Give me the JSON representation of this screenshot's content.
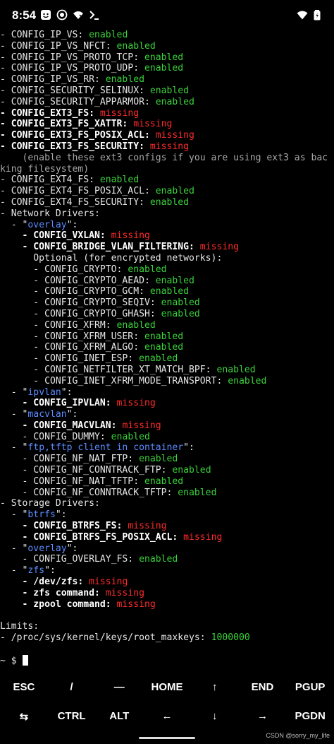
{
  "status": {
    "time": "8:54",
    "left_icons": [
      "face-icon",
      "record-icon",
      "wifi-off-icon",
      "terminal-icon"
    ],
    "right_icons": [
      "wifi-icon",
      "battery-icon"
    ]
  },
  "terminal": {
    "lines": [
      [
        {
          "t": "- CONFIG_IP_VS: ",
          "c": "plain"
        },
        {
          "t": "enabled",
          "c": "green"
        }
      ],
      [
        {
          "t": "- CONFIG_IP_VS_NFCT: ",
          "c": "plain"
        },
        {
          "t": "enabled",
          "c": "green"
        }
      ],
      [
        {
          "t": "- CONFIG_IP_VS_PROTO_TCP: ",
          "c": "plain"
        },
        {
          "t": "enabled",
          "c": "green"
        }
      ],
      [
        {
          "t": "- CONFIG_IP_VS_PROTO_UDP: ",
          "c": "plain"
        },
        {
          "t": "enabled",
          "c": "green"
        }
      ],
      [
        {
          "t": "- CONFIG_IP_VS_RR: ",
          "c": "plain"
        },
        {
          "t": "enabled",
          "c": "green"
        }
      ],
      [
        {
          "t": "- CONFIG_SECURITY_SELINUX: ",
          "c": "plain"
        },
        {
          "t": "enabled",
          "c": "green"
        }
      ],
      [
        {
          "t": "- CONFIG_SECURITY_APPARMOR: ",
          "c": "plain"
        },
        {
          "t": "enabled",
          "c": "green"
        }
      ],
      [
        {
          "t": "- CONFIG_EXT3_FS: ",
          "c": "bold"
        },
        {
          "t": "missing",
          "c": "red"
        }
      ],
      [
        {
          "t": "- CONFIG_EXT3_FS_XATTR: ",
          "c": "bold"
        },
        {
          "t": "missing",
          "c": "red"
        }
      ],
      [
        {
          "t": "- CONFIG_EXT3_FS_POSIX_ACL: ",
          "c": "bold"
        },
        {
          "t": "missing",
          "c": "red"
        }
      ],
      [
        {
          "t": "- CONFIG_EXT3_FS_SECURITY: ",
          "c": "bold"
        },
        {
          "t": "missing",
          "c": "red"
        }
      ],
      [
        {
          "t": "    (enable these ext3 configs if you are using ext3 as bac",
          "c": "gray"
        }
      ],
      [
        {
          "t": "king filesystem)",
          "c": "gray"
        }
      ],
      [
        {
          "t": "- CONFIG_EXT4_FS: ",
          "c": "plain"
        },
        {
          "t": "enabled",
          "c": "green"
        }
      ],
      [
        {
          "t": "- CONFIG_EXT4_FS_POSIX_ACL: ",
          "c": "plain"
        },
        {
          "t": "enabled",
          "c": "green"
        }
      ],
      [
        {
          "t": "- CONFIG_EXT4_FS_SECURITY: ",
          "c": "plain"
        },
        {
          "t": "enabled",
          "c": "green"
        }
      ],
      [
        {
          "t": "- Network Drivers:",
          "c": "plain"
        }
      ],
      [
        {
          "t": "  - \"",
          "c": "plain"
        },
        {
          "t": "overlay",
          "c": "blue"
        },
        {
          "t": "\":",
          "c": "plain"
        }
      ],
      [
        {
          "t": "    - CONFIG_VXLAN: ",
          "c": "bold"
        },
        {
          "t": "missing",
          "c": "red"
        }
      ],
      [
        {
          "t": "    - CONFIG_BRIDGE_VLAN_FILTERING: ",
          "c": "bold"
        },
        {
          "t": "missing",
          "c": "red"
        }
      ],
      [
        {
          "t": "      Optional (for encrypted networks):",
          "c": "plain"
        }
      ],
      [
        {
          "t": "      - CONFIG_CRYPTO: ",
          "c": "plain"
        },
        {
          "t": "enabled",
          "c": "green"
        }
      ],
      [
        {
          "t": "      - CONFIG_CRYPTO_AEAD: ",
          "c": "plain"
        },
        {
          "t": "enabled",
          "c": "green"
        }
      ],
      [
        {
          "t": "      - CONFIG_CRYPTO_GCM: ",
          "c": "plain"
        },
        {
          "t": "enabled",
          "c": "green"
        }
      ],
      [
        {
          "t": "      - CONFIG_CRYPTO_SEQIV: ",
          "c": "plain"
        },
        {
          "t": "enabled",
          "c": "green"
        }
      ],
      [
        {
          "t": "      - CONFIG_CRYPTO_GHASH: ",
          "c": "plain"
        },
        {
          "t": "enabled",
          "c": "green"
        }
      ],
      [
        {
          "t": "      - CONFIG_XFRM: ",
          "c": "plain"
        },
        {
          "t": "enabled",
          "c": "green"
        }
      ],
      [
        {
          "t": "      - CONFIG_XFRM_USER: ",
          "c": "plain"
        },
        {
          "t": "enabled",
          "c": "green"
        }
      ],
      [
        {
          "t": "      - CONFIG_XFRM_ALGO: ",
          "c": "plain"
        },
        {
          "t": "enabled",
          "c": "green"
        }
      ],
      [
        {
          "t": "      - CONFIG_INET_ESP: ",
          "c": "plain"
        },
        {
          "t": "enabled",
          "c": "green"
        }
      ],
      [
        {
          "t": "      - CONFIG_NETFILTER_XT_MATCH_BPF: ",
          "c": "plain"
        },
        {
          "t": "enabled",
          "c": "green"
        }
      ],
      [
        {
          "t": "      - CONFIG_INET_XFRM_MODE_TRANSPORT: ",
          "c": "plain"
        },
        {
          "t": "enabled",
          "c": "green"
        }
      ],
      [
        {
          "t": "  - \"",
          "c": "plain"
        },
        {
          "t": "ipvlan",
          "c": "blue"
        },
        {
          "t": "\":",
          "c": "plain"
        }
      ],
      [
        {
          "t": "    - CONFIG_IPVLAN: ",
          "c": "bold"
        },
        {
          "t": "missing",
          "c": "red"
        }
      ],
      [
        {
          "t": "  - \"",
          "c": "plain"
        },
        {
          "t": "macvlan",
          "c": "blue"
        },
        {
          "t": "\":",
          "c": "plain"
        }
      ],
      [
        {
          "t": "    - CONFIG_MACVLAN: ",
          "c": "bold"
        },
        {
          "t": "missing",
          "c": "red"
        }
      ],
      [
        {
          "t": "    - CONFIG_DUMMY: ",
          "c": "plain"
        },
        {
          "t": "enabled",
          "c": "green"
        }
      ],
      [
        {
          "t": "  - \"",
          "c": "plain"
        },
        {
          "t": "ftp,tftp client in container",
          "c": "blue"
        },
        {
          "t": "\":",
          "c": "plain"
        }
      ],
      [
        {
          "t": "    - CONFIG_NF_NAT_FTP: ",
          "c": "plain"
        },
        {
          "t": "enabled",
          "c": "green"
        }
      ],
      [
        {
          "t": "    - CONFIG_NF_CONNTRACK_FTP: ",
          "c": "plain"
        },
        {
          "t": "enabled",
          "c": "green"
        }
      ],
      [
        {
          "t": "    - CONFIG_NF_NAT_TFTP: ",
          "c": "plain"
        },
        {
          "t": "enabled",
          "c": "green"
        }
      ],
      [
        {
          "t": "    - CONFIG_NF_CONNTRACK_TFTP: ",
          "c": "plain"
        },
        {
          "t": "enabled",
          "c": "green"
        }
      ],
      [
        {
          "t": "- Storage Drivers:",
          "c": "plain"
        }
      ],
      [
        {
          "t": "  - \"",
          "c": "plain"
        },
        {
          "t": "btrfs",
          "c": "blue"
        },
        {
          "t": "\":",
          "c": "plain"
        }
      ],
      [
        {
          "t": "    - CONFIG_BTRFS_FS: ",
          "c": "bold"
        },
        {
          "t": "missing",
          "c": "red"
        }
      ],
      [
        {
          "t": "    - CONFIG_BTRFS_FS_POSIX_ACL: ",
          "c": "bold"
        },
        {
          "t": "missing",
          "c": "red"
        }
      ],
      [
        {
          "t": "  - \"",
          "c": "plain"
        },
        {
          "t": "overlay",
          "c": "blue"
        },
        {
          "t": "\":",
          "c": "plain"
        }
      ],
      [
        {
          "t": "    - CONFIG_OVERLAY_FS: ",
          "c": "plain"
        },
        {
          "t": "enabled",
          "c": "green"
        }
      ],
      [
        {
          "t": "  - \"",
          "c": "plain"
        },
        {
          "t": "zfs",
          "c": "blue"
        },
        {
          "t": "\":",
          "c": "plain"
        }
      ],
      [
        {
          "t": "    - /dev/zfs: ",
          "c": "bold"
        },
        {
          "t": "missing",
          "c": "red"
        }
      ],
      [
        {
          "t": "    - zfs command: ",
          "c": "bold"
        },
        {
          "t": "missing",
          "c": "red"
        }
      ],
      [
        {
          "t": "    - zpool command: ",
          "c": "bold"
        },
        {
          "t": "missing",
          "c": "red"
        }
      ],
      [],
      [
        {
          "t": "Limits:",
          "c": "plain"
        }
      ],
      [
        {
          "t": "- /proc/sys/kernel/keys/root_maxkeys: ",
          "c": "plain"
        },
        {
          "t": "1000000",
          "c": "green"
        }
      ],
      []
    ],
    "prompt": "~ $ "
  },
  "extra_keys": {
    "row1": [
      "ESC",
      "/",
      "—",
      "HOME",
      "↑",
      "END",
      "PGUP"
    ],
    "row2": [
      "⇆",
      "CTRL",
      "ALT",
      "←",
      "↓",
      "→",
      "PGDN"
    ]
  },
  "watermark": "CSDN @sorry_my_life"
}
